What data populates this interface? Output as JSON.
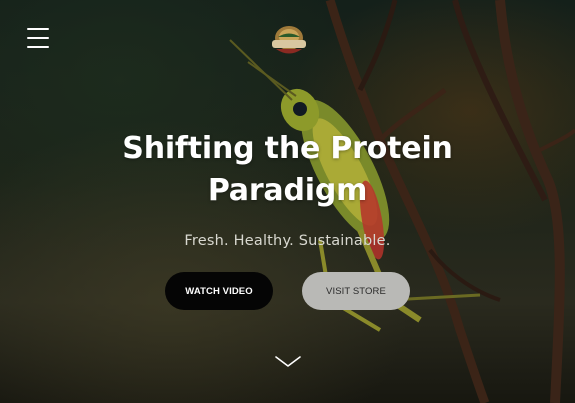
{
  "header": {
    "menu_icon": "hamburger-menu-icon",
    "logo_text": "CORALLO VALLEY FARMS"
  },
  "hero": {
    "headline_line1": "Shifting the Protein",
    "headline_line2": "Paradigm",
    "tagline": "Fresh. Healthy. Sustainable.",
    "watch_video_label": "WATCH VIDEO",
    "visit_store_label": "VISIT STORE",
    "scroll_icon": "chevron-down-icon"
  },
  "colors": {
    "watch_button_bg": "#050505",
    "store_button_bg": "#b9b9b6",
    "text": "#ffffff"
  }
}
